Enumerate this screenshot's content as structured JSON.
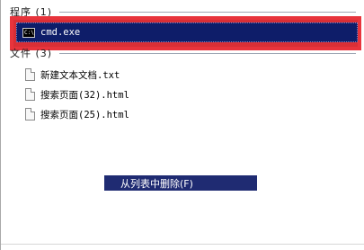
{
  "groups": {
    "programs_header": "程序 (1)",
    "files_header": "文件 (3)"
  },
  "programs": [
    {
      "label": "cmd.exe",
      "icon": "cmd-icon",
      "icon_text": "C:\\_",
      "selected": true
    }
  ],
  "files": [
    {
      "label": "新建文本文档.txt",
      "icon": "text-file-icon"
    },
    {
      "label": "搜索页面(32).html",
      "icon": "html-file-icon"
    },
    {
      "label": "搜索页面(25).html",
      "icon": "html-file-icon"
    }
  ],
  "context_menu": {
    "item_label": "从列表中删除(F)"
  },
  "colors": {
    "selection": "#0e1d69",
    "highlight_frame": "#e8343c",
    "menu_item": "#1f2b72"
  }
}
